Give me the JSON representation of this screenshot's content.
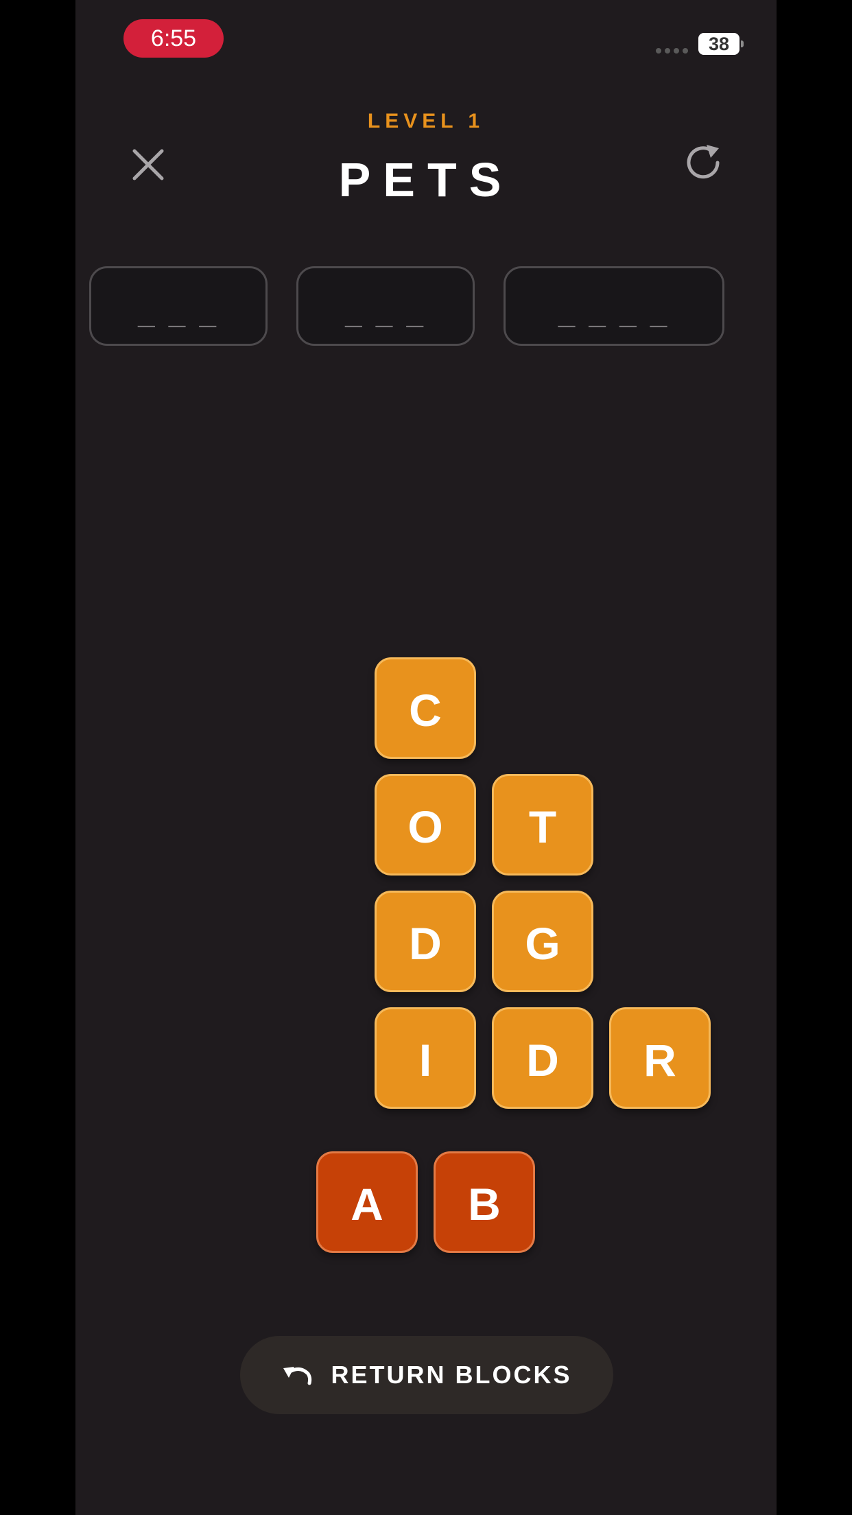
{
  "status_bar": {
    "time": "6:55",
    "battery": "38"
  },
  "header": {
    "level_label": "LEVEL 1",
    "title": "PETS",
    "close_icon": "close-icon",
    "restart_icon": "refresh-icon"
  },
  "answer_slots": [
    {
      "placeholder": "_ _ _",
      "letters": 3
    },
    {
      "placeholder": "_ _ _",
      "letters": 3
    },
    {
      "placeholder": "_ _ _ _",
      "letters": 4
    }
  ],
  "letter_blocks": {
    "stack": [
      {
        "letter": "C"
      },
      {
        "letter": "O"
      },
      {
        "letter": "T"
      },
      {
        "letter": "D"
      },
      {
        "letter": "G"
      },
      {
        "letter": "I"
      },
      {
        "letter": "D"
      },
      {
        "letter": "R"
      }
    ],
    "placed": [
      {
        "letter": "A"
      },
      {
        "letter": "B"
      }
    ]
  },
  "return_button": {
    "label": "RETURN BLOCKS",
    "icon": "undo-icon"
  },
  "colors": {
    "accent": "#e8921d",
    "tile_orange": "#e8921d",
    "tile_red": "#c64107",
    "background": "#1f1b1e",
    "time_pill": "#d3203a"
  }
}
